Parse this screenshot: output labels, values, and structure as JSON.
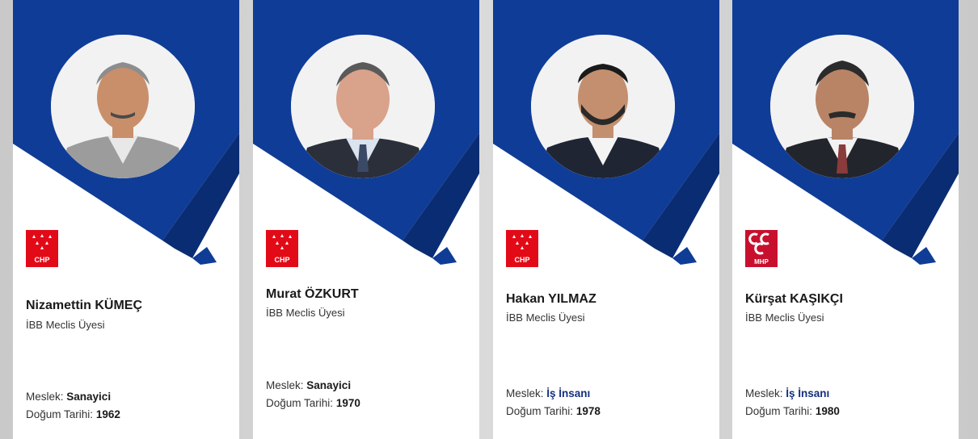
{
  "colors": {
    "banner": "#0f3c96",
    "banner_dark": "#0a2c73",
    "chp_red": "#e30a17",
    "mhp_red": "#c8102e"
  },
  "cards": [
    {
      "name": "Nizamettin KÜMEÇ",
      "role": "İBB Meclis Üyesi",
      "job_label": "Meslek:",
      "job": "Sanayici",
      "birth_label": "Doğum Tarihi:",
      "birth": "1962",
      "party_logo": "chp-logo",
      "logo_text": "CHP"
    },
    {
      "name": "Murat ÖZKURT",
      "role": "İBB Meclis Üyesi",
      "job_label": "Meslek:",
      "job": "Sanayici",
      "birth_label": "Doğum Tarihi:",
      "birth": "1970",
      "party_logo": "chp-logo",
      "logo_text": "CHP"
    },
    {
      "name": "Hakan YILMAZ",
      "role": "İBB Meclis Üyesi",
      "job_label": "Meslek:",
      "job": "İş İnsanı",
      "birth_label": "Doğum Tarihi:",
      "birth": "1978",
      "party_logo": "chp-logo",
      "logo_text": "CHP"
    },
    {
      "name": "Kürşat KAŞIKÇI",
      "role": "İBB Meclis Üyesi",
      "job_label": "Meslek:",
      "job": "İş İnsanı",
      "birth_label": "Doğum Tarihi:",
      "birth": "1980",
      "party_logo": "mhp-logo",
      "logo_text": "MHP"
    }
  ]
}
